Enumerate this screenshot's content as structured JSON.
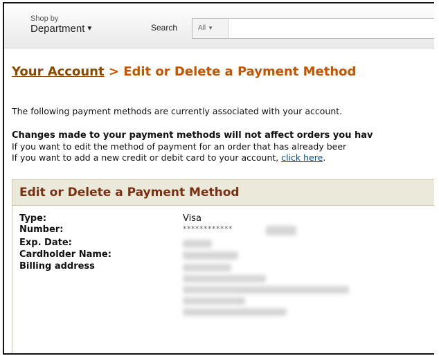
{
  "nav": {
    "shop_by_small": "Shop by",
    "shop_by_big": "Department",
    "search_label": "Search",
    "search_scope": "All",
    "search_value": ""
  },
  "breadcrumb": {
    "account_link": "Your Account",
    "separator": " > ",
    "current": "Edit or Delete a Payment Method"
  },
  "intro": {
    "line1": "The following payment methods are currently associated with your account.",
    "line2": "Changes made to your payment methods will not affect orders you hav",
    "line3": "If you want to edit the method of payment for an order that has already beer",
    "line4_prefix": "If you want to add a new credit or debit card to your account, ",
    "line4_link": "click here",
    "line4_suffix": "."
  },
  "panel": {
    "heading": "Edit or Delete a Payment Method",
    "fields": {
      "type_label": "Type:",
      "type_value": "Visa",
      "number_label": "Number:",
      "number_value": "************",
      "exp_label": "Exp. Date:",
      "cardholder_label": "Cardholder Name:",
      "billing_label": "Billing address"
    }
  },
  "colors": {
    "title": "#c45500",
    "panel_heading": "#7a2e12",
    "panel_bg": "#ebe9d9",
    "link": "#004b91"
  }
}
